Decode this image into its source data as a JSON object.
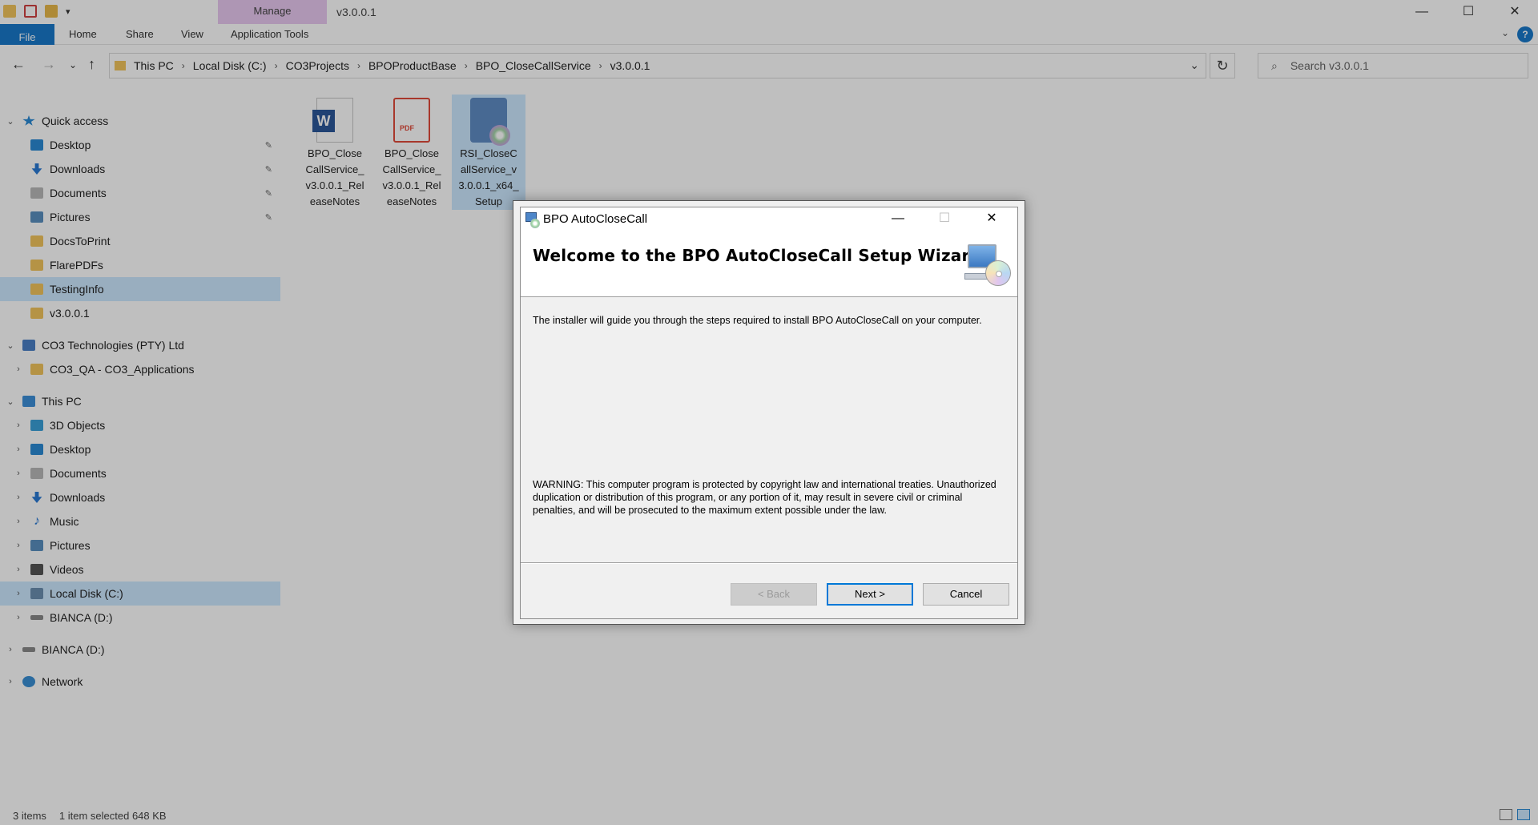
{
  "explorer": {
    "title": "v3.0.0.1",
    "manage_tab": "Manage",
    "ribbon_tabs": [
      "File",
      "Home",
      "Share",
      "View",
      "Application Tools"
    ],
    "help_label": "?",
    "window_controls": {
      "minimize": "—",
      "maximize": "☐",
      "close": "✕"
    },
    "breadcrumb": [
      "This PC",
      "Local Disk (C:)",
      "CO3Projects",
      "BPOProductBase",
      "BPO_CloseCallService",
      "v3.0.0.1"
    ],
    "search_placeholder": "Search v3.0.0.1",
    "nav": [
      {
        "label": "Quick access",
        "icon": "star-icon",
        "level": 0,
        "expanded": true
      },
      {
        "label": "Desktop",
        "icon": "desktop-icon",
        "level": 1,
        "pinned": true
      },
      {
        "label": "Downloads",
        "icon": "download-icon",
        "level": 1,
        "pinned": true
      },
      {
        "label": "Documents",
        "icon": "documents-icon",
        "level": 1,
        "pinned": true
      },
      {
        "label": "Pictures",
        "icon": "pictures-icon",
        "level": 1,
        "pinned": true
      },
      {
        "label": "DocsToPrint",
        "icon": "folder-icon",
        "level": 1
      },
      {
        "label": "FlarePDFs",
        "icon": "folder-icon",
        "level": 1
      },
      {
        "label": "TestingInfo",
        "icon": "folder-icon",
        "level": 1,
        "selected": true
      },
      {
        "label": "v3.0.0.1",
        "icon": "folder-icon",
        "level": 1
      },
      {
        "label": "CO3 Technologies (PTY) Ltd",
        "icon": "building-icon",
        "level": 0,
        "expanded": true
      },
      {
        "label": "CO3_QA - CO3_Applications",
        "icon": "folder-icon",
        "level": 1
      },
      {
        "label": "This PC",
        "icon": "computer-icon",
        "level": 0,
        "expanded": true
      },
      {
        "label": "3D Objects",
        "icon": "3d-objects-icon",
        "level": 1
      },
      {
        "label": "Desktop",
        "icon": "desktop-icon",
        "level": 1
      },
      {
        "label": "Documents",
        "icon": "documents-icon",
        "level": 1
      },
      {
        "label": "Downloads",
        "icon": "download-icon",
        "level": 1
      },
      {
        "label": "Music",
        "icon": "music-icon",
        "level": 1
      },
      {
        "label": "Pictures",
        "icon": "pictures-icon",
        "level": 1
      },
      {
        "label": "Videos",
        "icon": "videos-icon",
        "level": 1
      },
      {
        "label": "Local Disk (C:)",
        "icon": "disk-icon",
        "level": 1,
        "selected": true
      },
      {
        "label": "BIANCA (D:)",
        "icon": "drive-icon",
        "level": 1
      },
      {
        "label": "BIANCA (D:)",
        "icon": "drive-icon",
        "level": 0
      },
      {
        "label": "Network",
        "icon": "network-icon",
        "level": 0
      }
    ],
    "files": [
      {
        "name": "BPO_CloseCallService_v3.0.0.1_ReleaseNotes",
        "lines": [
          "BPO_Close",
          "CallService_",
          "v3.0.0.1_Rel",
          "easeNotes"
        ],
        "type": "word"
      },
      {
        "name": "BPO_CloseCallService_v3.0.0.1_ReleaseNotes",
        "lines": [
          "BPO_Close",
          "CallService_",
          "v3.0.0.1_Rel",
          "easeNotes"
        ],
        "type": "pdf"
      },
      {
        "name": "RSI_CloseCallService_v3.0.0.1_x64_Setup",
        "lines": [
          "RSI_CloseC",
          "allService_v",
          "3.0.0.1_x64_",
          "Setup"
        ],
        "type": "setup",
        "selected": true
      }
    ],
    "status": {
      "items": "3 items",
      "selection": "1 item selected  648 KB"
    }
  },
  "dialog": {
    "title": "BPO AutoCloseCall",
    "heading": "Welcome to the BPO AutoCloseCall Setup Wizard",
    "intro": "The installer will guide you through the steps required to install BPO AutoCloseCall on your computer.",
    "warning": "WARNING: This computer program is protected by copyright law and international treaties. Unauthorized duplication or distribution of this program, or any portion of it, may result in severe civil or criminal penalties, and will be prosecuted to the maximum extent possible under the law.",
    "buttons": {
      "back": "< Back",
      "next": "Next >",
      "cancel": "Cancel"
    },
    "controls": {
      "minimize": "—",
      "maximize": "☐",
      "close": "✕"
    }
  }
}
